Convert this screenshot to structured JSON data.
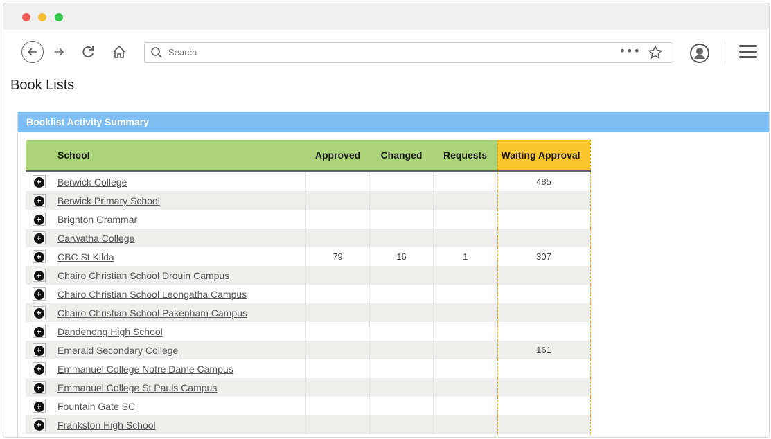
{
  "browser": {
    "search_placeholder": "Search",
    "more_label": "•••"
  },
  "page": {
    "title": "Book Lists"
  },
  "panel": {
    "title": "Booklist Activity Summary"
  },
  "table": {
    "headers": {
      "school": "School",
      "approved": "Approved",
      "changed": "Changed",
      "requests": "Requests",
      "waiting": "Waiting Approval"
    },
    "rows": [
      {
        "school": "Berwick College",
        "approved": "",
        "changed": "",
        "requests": "",
        "waiting": "485"
      },
      {
        "school": "Berwick Primary School",
        "approved": "",
        "changed": "",
        "requests": "",
        "waiting": ""
      },
      {
        "school": "Brighton Grammar",
        "approved": "",
        "changed": "",
        "requests": "",
        "waiting": ""
      },
      {
        "school": "Carwatha College",
        "approved": "",
        "changed": "",
        "requests": "",
        "waiting": ""
      },
      {
        "school": "CBC St Kilda",
        "approved": "79",
        "changed": "16",
        "requests": "1",
        "waiting": "307"
      },
      {
        "school": "Chairo Christian School Drouin Campus",
        "approved": "",
        "changed": "",
        "requests": "",
        "waiting": ""
      },
      {
        "school": "Chairo Christian School Leongatha Campus",
        "approved": "",
        "changed": "",
        "requests": "",
        "waiting": ""
      },
      {
        "school": "Chairo Christian School Pakenham Campus",
        "approved": "",
        "changed": "",
        "requests": "",
        "waiting": ""
      },
      {
        "school": "Dandenong High School",
        "approved": "",
        "changed": "",
        "requests": "",
        "waiting": ""
      },
      {
        "school": "Emerald Secondary College",
        "approved": "",
        "changed": "",
        "requests": "",
        "waiting": "161"
      },
      {
        "school": "Emmanuel College Notre Dame Campus",
        "approved": "",
        "changed": "",
        "requests": "",
        "waiting": ""
      },
      {
        "school": "Emmanuel College St Pauls Campus",
        "approved": "",
        "changed": "",
        "requests": "",
        "waiting": ""
      },
      {
        "school": "Fountain Gate SC",
        "approved": "",
        "changed": "",
        "requests": "",
        "waiting": ""
      },
      {
        "school": "Frankston High School",
        "approved": "",
        "changed": "",
        "requests": "",
        "waiting": ""
      }
    ]
  }
}
